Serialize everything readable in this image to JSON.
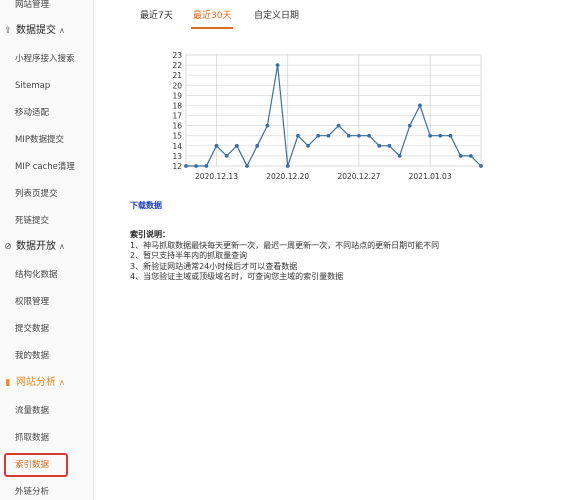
{
  "sidebar": {
    "top_item": "网站管理",
    "groups": [
      {
        "label": "数据提交",
        "icon": "upload-icon",
        "items": [
          "小程序接入搜索",
          "Sitemap",
          "移动适配",
          "MIP数据提交",
          "MIP cache清理",
          "列表页提交",
          "死链提交"
        ]
      },
      {
        "label": "数据开放",
        "icon": "link-icon",
        "items": [
          "结构化数据",
          "权限管理",
          "提交数据",
          "我的数据"
        ]
      },
      {
        "label": "网站分析",
        "icon": "bar-chart-icon",
        "items": [
          "流量数据",
          "抓取数据",
          "索引数据",
          "外链分析"
        ]
      }
    ],
    "selected_item": "索引数据"
  },
  "tabs": [
    {
      "label": "最近7天",
      "active": false
    },
    {
      "label": "最近30天",
      "active": true
    },
    {
      "label": "自定义日期",
      "active": false
    }
  ],
  "chart_data": {
    "type": "line",
    "y_ticks": [
      "23",
      "22",
      "21",
      "20",
      "19",
      "18",
      "17",
      "16",
      "15",
      "14",
      "13",
      "12"
    ],
    "ylim": [
      12,
      23
    ],
    "x_tick_labels": [
      "2020.12.13",
      "2020.12.20",
      "2020.12.27",
      "2021.01.03"
    ],
    "x_tick_index": [
      3,
      10,
      17,
      24
    ],
    "grid": true,
    "color": "#3a6fa6",
    "series": [
      {
        "values": [
          12,
          12,
          12,
          14,
          13,
          14,
          12,
          14,
          16,
          22,
          12,
          15,
          14,
          15,
          15,
          16,
          15,
          15,
          15,
          14,
          14,
          13,
          16,
          18,
          15,
          15,
          15,
          13,
          13,
          12
        ]
      }
    ]
  },
  "download_label": "下载数据",
  "notes": {
    "title": "索引说明：",
    "lines": [
      "1、神马抓取数据最快每天更新一次，最迟一周更新一次，不同站点的更新日期可能不同",
      "2、暂只支持半年内的抓取量查询",
      "3、新验证网站通常24小时候后才可以查看数据",
      "4、当您验证主域或顶级域名时，可查询您主域的索引量数据"
    ]
  }
}
